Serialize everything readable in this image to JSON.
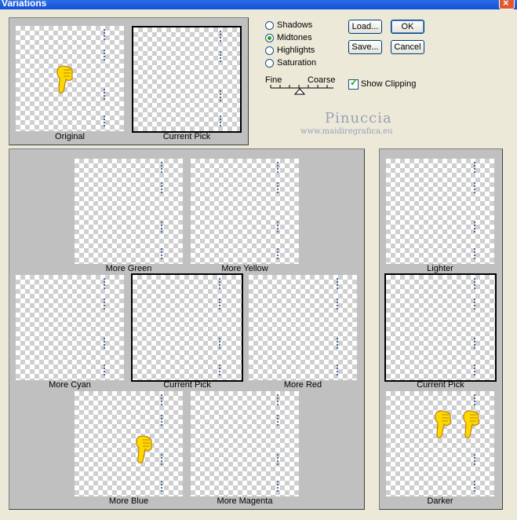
{
  "window": {
    "title": "Variations"
  },
  "top": {
    "original_label": "Original",
    "current_pick_label": "Current Pick"
  },
  "range": {
    "options": [
      {
        "label": "Shadows",
        "selected": false
      },
      {
        "label": "Midtones",
        "selected": true
      },
      {
        "label": "Highlights",
        "selected": false
      },
      {
        "label": "Saturation",
        "selected": false
      }
    ]
  },
  "fine_coarse": {
    "fine_label": "Fine",
    "coarse_label": "Coarse"
  },
  "buttons": {
    "load": "Load...",
    "ok": "OK",
    "save": "Save...",
    "cancel": "Cancel"
  },
  "show_clipping": {
    "label": "Show Clipping",
    "checked": true
  },
  "watermark": {
    "name": "Pinuccia",
    "url": "www.maidiregrafica.eu"
  },
  "color_grid": {
    "more_green": "More Green",
    "more_yellow": "More Yellow",
    "more_cyan": "More Cyan",
    "current_pick": "Current Pick",
    "more_red": "More Red",
    "more_blue": "More Blue",
    "more_magenta": "More Magenta"
  },
  "brightness": {
    "lighter": "Lighter",
    "current_pick": "Current Pick",
    "darker": "Darker"
  },
  "colors": {
    "hand_fill": "#ffd800",
    "hand_outline": "#b8860b",
    "title_bar": "#1450d6"
  }
}
